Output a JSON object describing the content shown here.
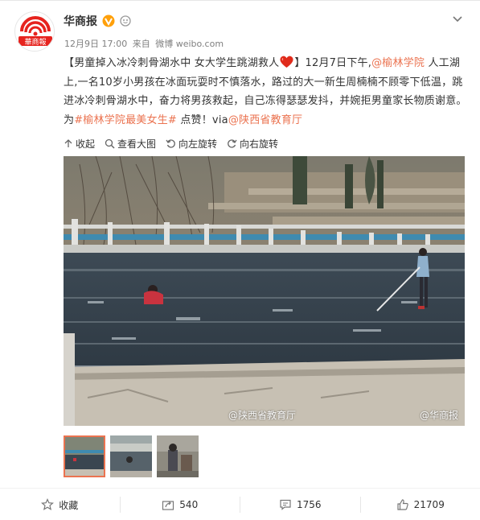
{
  "account": {
    "name": "华商报",
    "avatar_text": "華商報"
  },
  "meta": {
    "time": "12月9日 17:00",
    "source_prefix": "来自",
    "source": "微博 weibo.com"
  },
  "content": {
    "part1": "【男童掉入冰冷刺骨湖水中  女大学生跳湖救人",
    "part2": "】12月7日下午,",
    "link1": "@榆林学院",
    "part3": "人工湖上,一名10岁小男孩在冰面玩耍时不慎落水，路过的大一新生周楠楠不顾零下低温，跳进冰冷刺骨湖水中，奋力将男孩救起，自己冻得瑟瑟发抖，并婉拒男童家长物质谢意。为",
    "link2": "#榆林学院最美女生#",
    "part4": " 点赞！via",
    "link3": "@陕西省教育厅"
  },
  "toolbar": {
    "collapse": "收起",
    "view_large": "查看大图",
    "rotate_left": "向左旋转",
    "rotate_right": "向右旋转"
  },
  "photo": {
    "watermark_left": "@陕西省教育厅",
    "watermark_right": "@华商报"
  },
  "actions": {
    "favorite": "收藏",
    "forward": "540",
    "comment": "1756",
    "like": "21709"
  },
  "colors": {
    "link": "#eb7350",
    "text": "#333333",
    "meta": "#808080",
    "verified": "#ffa00a"
  }
}
